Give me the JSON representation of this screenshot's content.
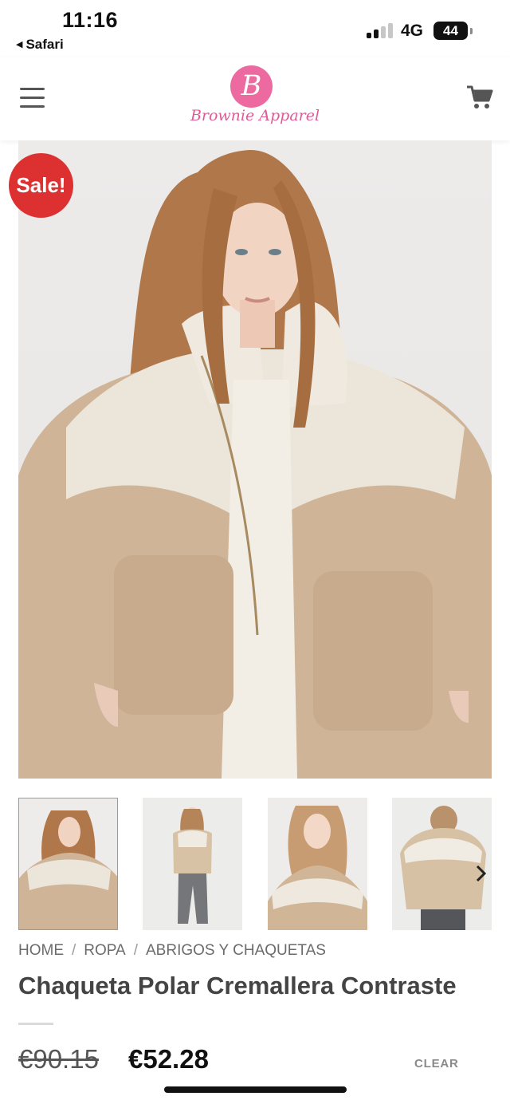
{
  "status_bar": {
    "time": "11:16",
    "back_app": "Safari",
    "network": "4G",
    "battery": "44"
  },
  "header": {
    "logo_letter": "B",
    "logo_text": "Brownie Apparel",
    "menu_icon": "hamburger-menu-icon",
    "cart_icon": "shopping-cart-icon",
    "brand_color": "#ec6aa0"
  },
  "product": {
    "sale_badge": "Sale!",
    "sale_color": "#dd3131",
    "breadcrumb": [
      "HOME",
      "ROPA",
      "ABRIGOS Y CHAQUETAS"
    ],
    "breadcrumb_separator": "/",
    "title": "Chaqueta Polar Cremallera Contraste",
    "price_old": "€90.15",
    "price_new": "€52.28",
    "clear_label": "CLEAR",
    "gallery_next_icon": "chevron-right-icon"
  }
}
